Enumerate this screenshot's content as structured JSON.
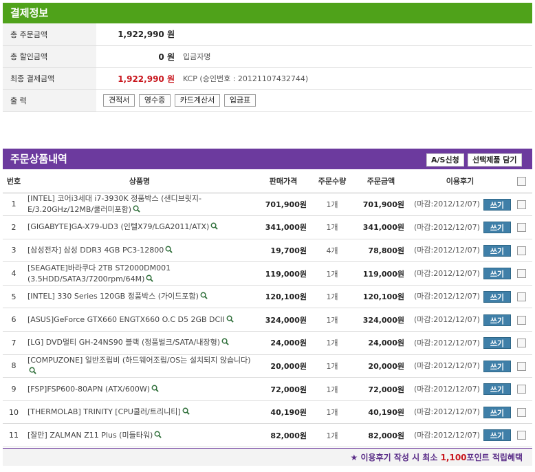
{
  "payment": {
    "title": "결제정보",
    "rows": [
      {
        "label": "총 주문금액",
        "amount": "1,922,990 원",
        "extra": ""
      },
      {
        "label": "총 할인금액",
        "amount": "0 원",
        "extra": "입금자명"
      },
      {
        "label": "최종 결제금액",
        "amount": "1,922,990 원",
        "extra": "KCP (승인번호 : 20121107432744)"
      }
    ],
    "print_label": "출 력",
    "print_buttons": [
      "견적서",
      "영수증",
      "카드계산서",
      "입금표"
    ]
  },
  "orders": {
    "title": "주문상품내역",
    "as_button": "A/S신청",
    "cart_button": "선택제품 담기",
    "columns": [
      "번호",
      "상품명",
      "판매가격",
      "주문수량",
      "주문금액",
      "이용후기"
    ],
    "items": [
      {
        "no": "1",
        "name": "[INTEL] 코어i3세대 i7-3930K 정품박스 (샌디브릿지-E/3.20GHz/12MB/쿨러미포함)",
        "price": "701,900원",
        "qty": "1개",
        "amount": "701,900원",
        "deadline": "(마감:2012/12/07)",
        "write": "쓰기"
      },
      {
        "no": "2",
        "name": "[GIGABYTE]GA-X79-UD3 (인텔X79/LGA2011/ATX)",
        "price": "341,000원",
        "qty": "1개",
        "amount": "341,000원",
        "deadline": "(마감:2012/12/07)",
        "write": "쓰기"
      },
      {
        "no": "3",
        "name": "[삼성전자] 삼성 DDR3 4GB PC3-12800",
        "price": "19,700원",
        "qty": "4개",
        "amount": "78,800원",
        "deadline": "(마감:2012/12/07)",
        "write": "쓰기"
      },
      {
        "no": "4",
        "name": "[SEAGATE]바라쿠다 2TB ST2000DM001 (3.5HDD/SATA3/7200rpm/64M)",
        "price": "119,000원",
        "qty": "1개",
        "amount": "119,000원",
        "deadline": "(마감:2012/12/07)",
        "write": "쓰기"
      },
      {
        "no": "5",
        "name": "[INTEL] 330 Series 120GB 정품박스 (가이드포함)",
        "price": "120,100원",
        "qty": "1개",
        "amount": "120,100원",
        "deadline": "(마감:2012/12/07)",
        "write": "쓰기"
      },
      {
        "no": "6",
        "name": "[ASUS]GeForce GTX660 ENGTX660 O.C D5 2GB DCII",
        "price": "324,000원",
        "qty": "1개",
        "amount": "324,000원",
        "deadline": "(마감:2012/12/07)",
        "write": "쓰기"
      },
      {
        "no": "7",
        "name": "[LG] DVD멀티 GH-24NS90 블랙 (정품벌크/SATA/내장형)",
        "price": "24,000원",
        "qty": "1개",
        "amount": "24,000원",
        "deadline": "(마감:2012/12/07)",
        "write": "쓰기"
      },
      {
        "no": "8",
        "name": "[COMPUZONE] 일반조립비 (하드웨어조립/OS는 설치되지 않습니다)",
        "price": "20,000원",
        "qty": "1개",
        "amount": "20,000원",
        "deadline": "(마감:2012/12/07)",
        "write": "쓰기"
      },
      {
        "no": "9",
        "name": "[FSP]FSP600-80APN (ATX/600W)",
        "price": "72,000원",
        "qty": "1개",
        "amount": "72,000원",
        "deadline": "(마감:2012/12/07)",
        "write": "쓰기"
      },
      {
        "no": "10",
        "name": "[THERMOLAB] TRINITY [CPU쿨러/트리니티]",
        "price": "40,190원",
        "qty": "1개",
        "amount": "40,190원",
        "deadline": "(마감:2012/12/07)",
        "write": "쓰기"
      },
      {
        "no": "11",
        "name": "[잘만] ZALMAN Z11 Plus (미들타워)",
        "price": "82,000원",
        "qty": "1개",
        "amount": "82,000원",
        "deadline": "(마감:2012/12/07)",
        "write": "쓰기"
      }
    ],
    "footer": {
      "star": "★",
      "prefix": "이용후기 작성 시 최소 ",
      "highlight": "1,100",
      "suffix": "포인트 적립혜택"
    }
  },
  "colors": {
    "payment_header": "#4fa21a",
    "orders_header": "#6c3a9e",
    "highlight_red": "#c8161d",
    "write_button": "#3f7fa8"
  },
  "icons": {
    "product_detail": "magnifier-icon",
    "footer": "star-icon"
  }
}
